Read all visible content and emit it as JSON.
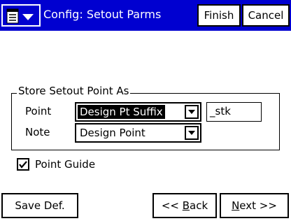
{
  "window": {
    "title": "Config: Setout Parms",
    "menu_icon": "list-menu-icon",
    "finish_label": "Finish",
    "cancel_label": "Cancel"
  },
  "colors": {
    "titlebar": "#0000d0",
    "background": "#ffffff",
    "text": "#000000"
  },
  "store_group": {
    "title": "Store Setout Point As",
    "point_label": "Point",
    "point_value": "Design Pt Suffix",
    "suffix_value": "_stk",
    "note_label": "Note",
    "note_value": "Design Point"
  },
  "point_guide": {
    "label": "Point Guide",
    "checked": true
  },
  "footer": {
    "save_def_label": "Save Def.",
    "back_prefix": "<< ",
    "back_key": "B",
    "back_rest": "ack",
    "next_key": "N",
    "next_rest": "ext >>"
  }
}
